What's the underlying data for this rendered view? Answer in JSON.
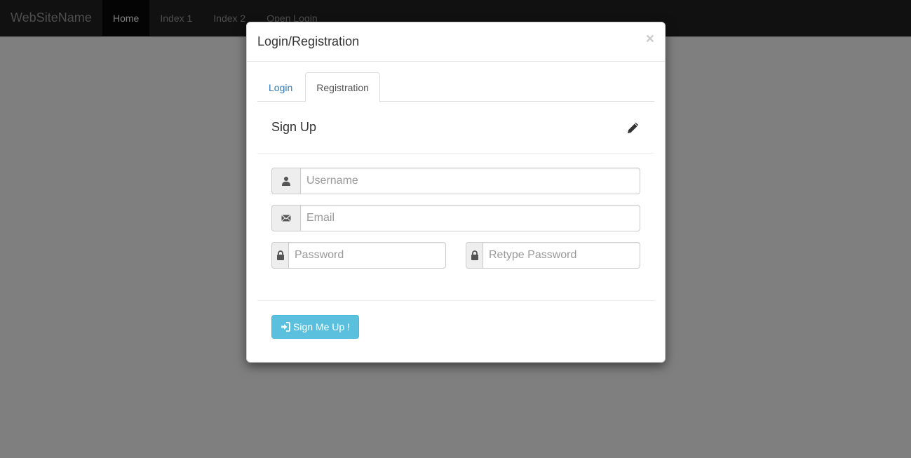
{
  "navbar": {
    "brand": "WebSiteName",
    "items": [
      {
        "label": "Home",
        "active": true
      },
      {
        "label": "Index 1",
        "active": false
      },
      {
        "label": "Index 2",
        "active": false
      },
      {
        "label": "Open Login",
        "active": false
      }
    ]
  },
  "modal": {
    "title": "Login/Registration",
    "close": "×",
    "tabs": [
      {
        "label": "Login",
        "active": false
      },
      {
        "label": "Registration",
        "active": true
      }
    ],
    "panel": {
      "title": "Sign Up",
      "icon": "pencil-icon"
    },
    "fields": {
      "username": {
        "placeholder": "Username",
        "value": "",
        "icon": "user-icon"
      },
      "email": {
        "placeholder": "Email",
        "value": "",
        "icon": "envelope-icon"
      },
      "password": {
        "placeholder": "Password",
        "value": "",
        "icon": "lock-icon"
      },
      "retype_password": {
        "placeholder": "Retype Password",
        "value": "",
        "icon": "lock-icon"
      }
    },
    "submit": {
      "label": "Sign Me Up !",
      "icon": "log-in-icon"
    }
  },
  "colors": {
    "navbar_bg": "#222222",
    "nav_active_bg": "#080808",
    "link": "#337ab7",
    "button_info": "#5bc0de",
    "backdrop": "rgba(0,0,0,0.5)"
  }
}
